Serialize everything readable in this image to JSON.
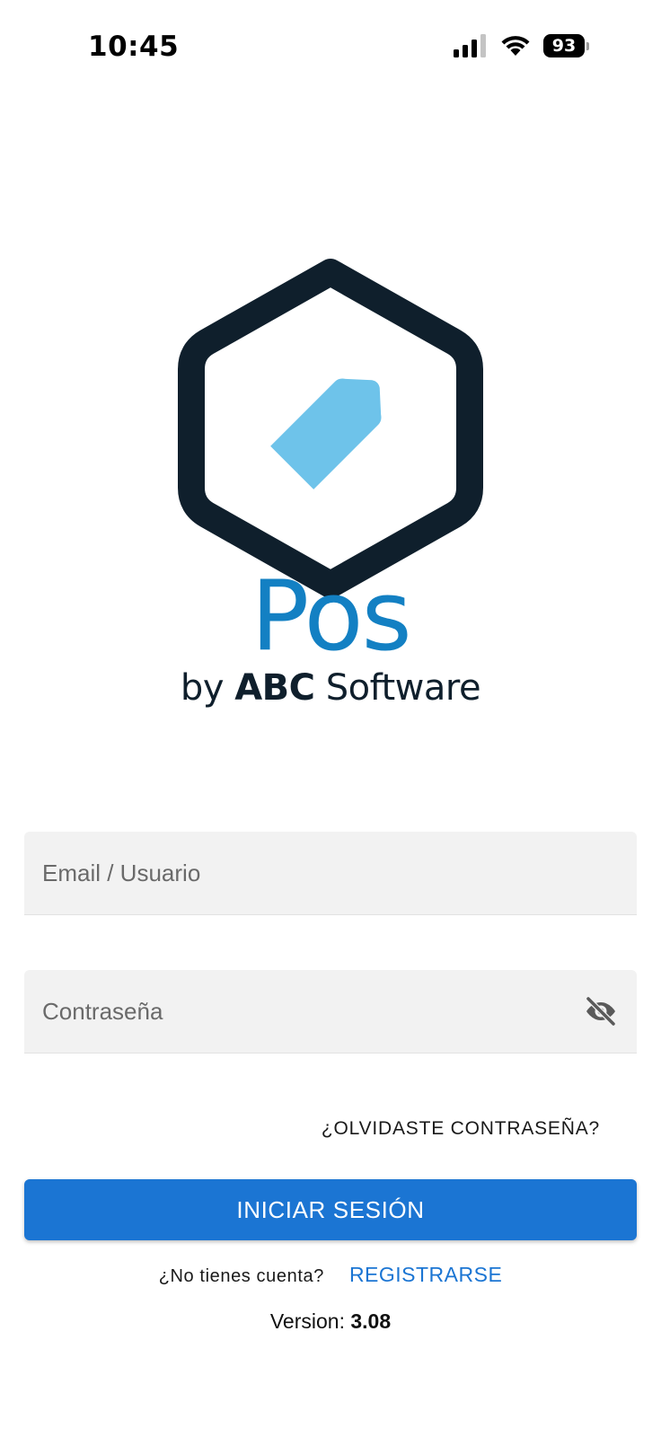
{
  "status_bar": {
    "time": "10:45",
    "battery": "93",
    "icons": [
      "signal-icon",
      "wifi-icon",
      "battery-icon"
    ]
  },
  "logo": {
    "app_name": "Pos",
    "by": "by",
    "company_bold": "ABC",
    "company_rest": "Software",
    "icon": "price-tag-hexagon-icon",
    "colors": {
      "hexagon": "#0f1f2c",
      "tag": "#6ec3ea",
      "app_name": "#1380c3"
    }
  },
  "form": {
    "email_placeholder": "Email / Usuario",
    "password_placeholder": "Contraseña",
    "password_toggle_icon": "eye-off-icon",
    "forgot_password": "¿OLVIDASTE CONTRASEÑA?",
    "login_button": "INICIAR SESIÓN"
  },
  "footer": {
    "no_account": "¿No tienes cuenta?",
    "register": "REGISTRARSE",
    "version_label": "Version:",
    "version_number": "3.08"
  },
  "colors": {
    "primary": "#1b75d3",
    "field_background": "#f2f2f2"
  }
}
